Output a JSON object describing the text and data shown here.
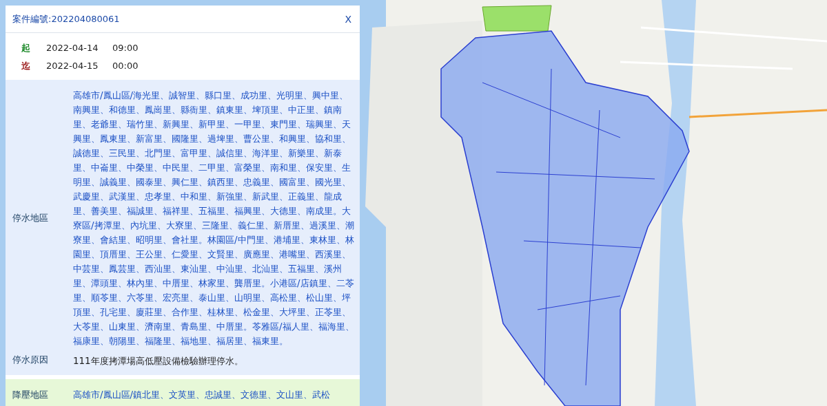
{
  "popup": {
    "title": "案件編號:202204080061",
    "close": "X"
  },
  "schedule": [
    {
      "kind": "start",
      "label": "起",
      "date": "2022-04-14",
      "time": "09:00"
    },
    {
      "kind": "end",
      "label": "迄",
      "date": "2022-04-15",
      "time": "00:00"
    }
  ],
  "sections": [
    {
      "kind": "outage",
      "rows": [
        {
          "kind": "area",
          "label": "停水地區",
          "value": "高雄市/鳳山區/海光里、誠智里、縣口里、成功里、光明里、興中里、南興里、和德里、鳳崗里、縣衙里、鎮東里、埤頂里、中正里、鎮南里、老爺里、瑞竹里、新興里、新甲里、一甲里、東門里、瑞興里、天興里、鳳東里、新富里、國隆里、過埤里、曹公里、和興里、協和里、誠德里、三民里、北門里、富甲里、誠信里、海洋里、新樂里、新泰里、中崙里、中榮里、中民里、二甲里、富榮里、南和里、保安里、生明里、誠義里、國泰里、興仁里、鎮西里、忠義里、國富里、國光里、武慶里、武漢里、忠孝里、中和里、新強里、新武里、正義里、龍成里、善美里、福誠里、福祥里、五福里、福興里、大德里、南成里。大寮區/拷潭里、內坑里、大寮里、三隆里、義仁里、新厝里、過溪里、潮寮里、會結里、昭明里、會社里。林園區/中門里、港埔里、東林里、林園里、頂厝里、王公里、仁愛里、文賢里、廣應里、港嘴里、西溪里、中芸里、鳳芸里、西汕里、東汕里、中汕里、北汕里、五福里、溪州里、潭頭里、林內里、中厝里、林家里、龔厝里。小港區/店鎮里、二苓里、順苓里、六苓里、宏亮里、泰山里、山明里、高松里、松山里、坪頂里、孔宅里、廈莊里、合作里、桂林里、松金里、大坪里、正苓里、大苓里、山東里、濟南里、青島里、中厝里。苓雅區/福人里、福海里、福康里、朝陽里、福隆里、福地里、福居里、福東里。"
        },
        {
          "kind": "reason",
          "label": "停水原因",
          "value": "111年度拷潭場高低壓設備檢驗辦理停水。"
        }
      ]
    },
    {
      "kind": "pressure",
      "rows": [
        {
          "kind": "area",
          "label": "降壓地區",
          "value": "高雄市/鳳山區/鎮北里、文英里、忠誠里、文德里、文山里、武松"
        }
      ]
    }
  ]
}
